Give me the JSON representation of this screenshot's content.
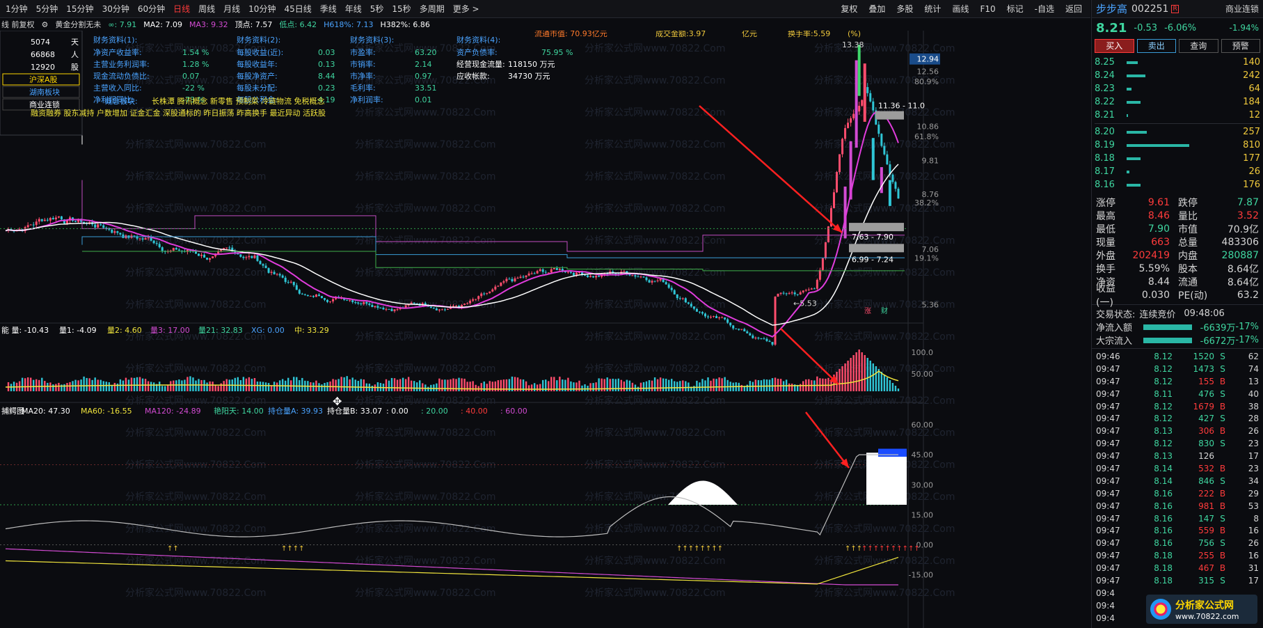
{
  "toolbar": {
    "periods": [
      "1分钟",
      "5分钟",
      "15分钟",
      "30分钟",
      "60分钟",
      "日线",
      "周线",
      "月线",
      "10分钟",
      "45日线",
      "季线",
      "年线",
      "5秒",
      "15秒",
      "多周期",
      "更多 >"
    ],
    "active_period": "日线",
    "tools": [
      "复权",
      "叠加",
      "多股",
      "统计",
      "画线",
      "F10",
      "标记",
      "-自选",
      "返回"
    ]
  },
  "indicator_line": {
    "mode": "线 前复权",
    "name": "黄金分割无未",
    "items": [
      {
        "text": "∞: 7.91",
        "color": "#3fd6a0"
      },
      {
        "text": "MA2: 7.09",
        "color": "#ffffff"
      },
      {
        "text": "MA3: 9.32",
        "color": "#d24bd2"
      },
      {
        "text": "顶点: 7.57",
        "color": "#ffffff"
      },
      {
        "text": "低点: 6.42",
        "color": "#3fd6a0"
      },
      {
        "text": "H618%: 7.13",
        "color": "#4aa3ff"
      },
      {
        "text": "H382%: 6.86",
        "color": "#ffffff"
      }
    ]
  },
  "left_info": {
    "rows": [
      {
        "val": "5074",
        "unit": "天"
      },
      {
        "val": "66868",
        "unit": "人"
      },
      {
        "val": "12920",
        "unit": "股"
      }
    ],
    "boards": [
      "沪深A股",
      "湖南板块",
      "商业连锁"
    ]
  },
  "finance": {
    "col1_title": "财务资料(1):",
    "col1": [
      [
        "净资产收益率:",
        "1.54 %"
      ],
      [
        "主营业务利润率:",
        "1.28 %"
      ],
      [
        "现金流动负债比:",
        "0.07"
      ],
      [
        "主营收入同比:",
        "-22 %"
      ],
      [
        "净利润同比:",
        "-73 %"
      ]
    ],
    "col2_title": "财务资料(2):",
    "col2": [
      [
        "每股收益(近):",
        "0.03"
      ],
      [
        "每股收益年:",
        "0.13"
      ],
      [
        "每股净资产:",
        "8.44"
      ],
      [
        "每股未分配:",
        "0.23"
      ],
      [
        "每股公积金:",
        "4.19"
      ]
    ],
    "col3_title": "财务资料(3):",
    "col3": [
      [
        "市盈率:",
        "63.20"
      ],
      [
        "市销率:",
        "2.14"
      ],
      [
        "市净率:",
        "0.97"
      ],
      [
        "毛利率:",
        "33.51"
      ],
      [
        "净利润率:",
        "0.01"
      ]
    ],
    "col4_title": "财务资料(4):",
    "col4": [
      [
        "资产负债率:",
        "75.95 %"
      ],
      [
        "经营现金流量:",
        "118150 万元"
      ],
      [
        "应收帐款:",
        "34730 万元"
      ]
    ],
    "circ_value": "流通市值: 70.93亿元",
    "turnover_amount": "成交金额:3.97",
    "unit_yi": "亿元",
    "turnover_rate": "换手率:5.59",
    "pct": "(%)",
    "concept_label": "概念板块:",
    "concepts": "长株潭 腾讯概念 新零售 预制菜 冷链物流 免税概念",
    "concepts2": "融资融券 股东减持 户数增加 证金汇金 深股通标的 昨日振荡 昨高换手 最近异动 活跃股"
  },
  "price_axis": [
    {
      "label": "12.94",
      "y": 12.94,
      "boxed": true
    },
    {
      "label": "12.56",
      "y": 12.56
    },
    {
      "label": "80.9%",
      "y": 12.25
    },
    {
      "label": "10.86",
      "y": 10.86
    },
    {
      "label": "61.8%",
      "y": 10.55
    },
    {
      "label": "9.81",
      "y": 9.81
    },
    {
      "label": "8.76",
      "y": 8.76
    },
    {
      "label": "38.2%",
      "y": 8.5
    },
    {
      "label": "7.06",
      "y": 7.06
    },
    {
      "label": "19.1%",
      "y": 6.8
    },
    {
      "label": "5.36",
      "y": 5.36
    }
  ],
  "annotations": {
    "high": "13.38",
    "low": "←5.53",
    "zone1": "11.36 - 11.0",
    "zone2": "7.63 - 7.90",
    "zone3": "6.99 - 7.24",
    "tag1": "涨",
    "tag2": "财"
  },
  "vol_indicator": {
    "items": [
      {
        "text": "能 量: -10.43",
        "color": "#ffffff"
      },
      {
        "text": "量1: -4.09",
        "color": "#ffffff"
      },
      {
        "text": "量2: 4.60",
        "color": "#f0e43c"
      },
      {
        "text": "量3: 17.00",
        "color": "#d24bd2"
      },
      {
        "text": "量21: 32.83",
        "color": "#3fd6a0"
      },
      {
        "text": "XG: 0.00",
        "color": "#4aa3ff"
      },
      {
        "text": "中: 33.29",
        "color": "#f0e43c"
      }
    ],
    "axis": [
      "100.0",
      "50.00"
    ]
  },
  "pos_indicator": {
    "items": [
      {
        "text": "捕鳄图",
        "color": "#ffffff"
      },
      {
        "text": "MA20: 47.30",
        "color": "#ffffff"
      },
      {
        "text": "MA60: -16.55",
        "color": "#f0e43c"
      },
      {
        "text": "MA120: -24.89",
        "color": "#d24bd2"
      },
      {
        "text": "艳阳天: 14.00",
        "color": "#3fd6a0"
      },
      {
        "text": "持仓量A: 39.93",
        "color": "#4aa3ff"
      },
      {
        "text": "持仓量B: 33.07",
        "color": "#ffffff"
      },
      {
        "text": ": 0.00",
        "color": "#ffffff"
      },
      {
        "text": ": 20.00",
        "color": "#3fd6a0"
      },
      {
        "text": ": 40.00",
        "color": "#ff3b3b"
      },
      {
        "text": ": 60.00",
        "color": "#d24bd2"
      }
    ],
    "axis": [
      "60.00",
      "45.00",
      "30.00",
      "15.00",
      "0.00",
      "-15.00"
    ]
  },
  "quote": {
    "name": "步步高",
    "code": "002251",
    "tag": "R",
    "industry": "商业连锁",
    "price": "8.21",
    "change": "-0.53",
    "pct": "-6.06%",
    "vol_pct": "-1.94%",
    "buttons": [
      "买入",
      "卖出",
      "查询",
      "预警"
    ],
    "asks": [
      [
        "8.25",
        "140",
        0.18
      ],
      [
        "8.24",
        "242",
        0.3
      ],
      [
        "8.23",
        "64",
        0.08
      ],
      [
        "8.22",
        "184",
        0.22
      ],
      [
        "8.21",
        "12",
        0.02
      ]
    ],
    "bids": [
      [
        "8.20",
        "257",
        0.32
      ],
      [
        "8.19",
        "810",
        1.0
      ],
      [
        "8.18",
        "177",
        0.22
      ],
      [
        "8.17",
        "26",
        0.04
      ],
      [
        "8.16",
        "176",
        0.22
      ]
    ],
    "stats": [
      [
        "涨停",
        "9.61",
        "#ff3b3b",
        "跌停",
        "7.87",
        "#3fd6a0"
      ],
      [
        "最高",
        "8.46",
        "#ff3b3b",
        "量比",
        "3.52",
        "#ff3b3b"
      ],
      [
        "最低",
        "7.90",
        "#3fd6a0",
        "市值",
        "70.9亿",
        "#d6d6d6"
      ],
      [
        "现量",
        "663",
        "#ff3b3b",
        "总量",
        "483306",
        "#d6d6d6"
      ],
      [
        "外盘",
        "202419",
        "#ff3b3b",
        "内盘",
        "280887",
        "#3fd6a0"
      ],
      [
        "换手",
        "5.59%",
        "#d6d6d6",
        "股本",
        "8.64亿",
        "#d6d6d6"
      ],
      [
        "净资",
        "8.44",
        "#d6d6d6",
        "流通",
        "8.64亿",
        "#d6d6d6"
      ],
      [
        "收益(一)",
        "0.030",
        "#d6d6d6",
        "PE(动)",
        "63.2",
        "#d6d6d6"
      ]
    ],
    "state_label": "交易状态:",
    "state": "连续竞价",
    "time": "09:48:06",
    "flows": [
      [
        "净流入额",
        "-6639万",
        "-17%"
      ],
      [
        "大宗流入",
        "-6672万",
        "-17%"
      ]
    ],
    "ticks": [
      [
        "09:46",
        "8.12",
        "1520",
        "S",
        "62"
      ],
      [
        "09:47",
        "8.12",
        "1473",
        "S",
        "74"
      ],
      [
        "09:47",
        "8.12",
        "155",
        "B",
        "13"
      ],
      [
        "09:47",
        "8.11",
        "476",
        "S",
        "40"
      ],
      [
        "09:47",
        "8.12",
        "1679",
        "B",
        "38"
      ],
      [
        "09:47",
        "8.12",
        "427",
        "S",
        "28"
      ],
      [
        "09:47",
        "8.13",
        "306",
        "B",
        "26"
      ],
      [
        "09:47",
        "8.12",
        "830",
        "S",
        "23"
      ],
      [
        "09:47",
        "8.13",
        "126",
        "",
        "17"
      ],
      [
        "09:47",
        "8.14",
        "532",
        "B",
        "23"
      ],
      [
        "09:47",
        "8.14",
        "846",
        "S",
        "34"
      ],
      [
        "09:47",
        "8.16",
        "222",
        "B",
        "29"
      ],
      [
        "09:47",
        "8.16",
        "981",
        "B",
        "53"
      ],
      [
        "09:47",
        "8.16",
        "147",
        "S",
        "8"
      ],
      [
        "09:47",
        "8.16",
        "559",
        "B",
        "16"
      ],
      [
        "09:47",
        "8.16",
        "756",
        "S",
        "26"
      ],
      [
        "09:47",
        "8.18",
        "255",
        "B",
        "16"
      ],
      [
        "09:47",
        "8.18",
        "467",
        "B",
        "31"
      ],
      [
        "09:47",
        "8.18",
        "315",
        "S",
        "17"
      ],
      [
        "09:4",
        "",
        "",
        "",
        ""
      ],
      [
        "09:4",
        "",
        "",
        "",
        ""
      ],
      [
        "09:4",
        "",
        "",
        "",
        ""
      ]
    ]
  },
  "logo": {
    "t1": "分析家公式网",
    "t2": "www.70822.com"
  },
  "watermark": "分析家公式网www.70822.Com"
}
